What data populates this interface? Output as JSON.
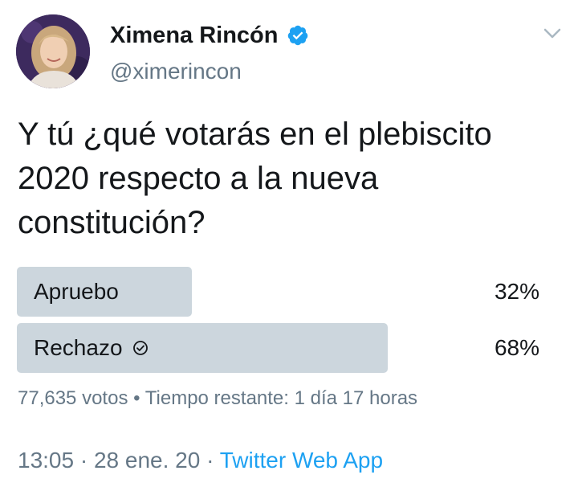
{
  "author": {
    "display_name": "Ximena Rincón",
    "handle": "@ximerincon",
    "verified_icon": "verified-badge-icon",
    "verified_color": "#1da1f2"
  },
  "tweet": {
    "text": "Y tú ¿qué votarás en el plebiscito 2020 respecto a la nueva constitución?"
  },
  "poll": {
    "options": [
      {
        "label": "Apruebo",
        "percent": "32%",
        "fraction": 0.32,
        "selected": false
      },
      {
        "label": "Rechazo",
        "percent": "68%",
        "fraction": 0.68,
        "selected": true
      }
    ],
    "votes": "77,635 votos",
    "separator": "•",
    "time_remaining": "Tiempo restante: 1 día 17 horas"
  },
  "footer": {
    "time": "13:05",
    "dot1": "·",
    "date": "28 ene. 20",
    "dot2": "·",
    "source": "Twitter Web App"
  },
  "colors": {
    "bar": "#ccd6dd",
    "text": "#14171a",
    "muted": "#657786",
    "link": "#1da1f2"
  }
}
